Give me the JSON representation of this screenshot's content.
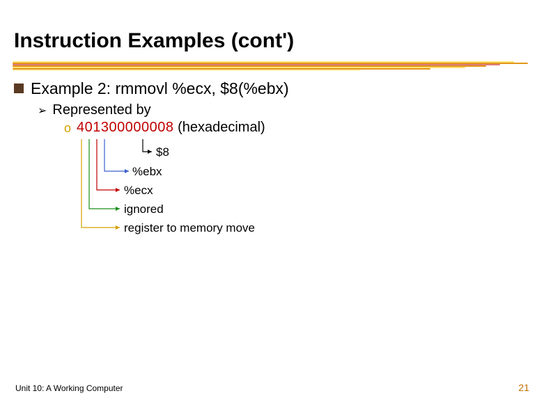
{
  "title": "Instruction Examples (cont')",
  "bullet": {
    "label": "Example 2: rmmovl %ecx, $8(%ebx)"
  },
  "sub1": {
    "label": "Represented by"
  },
  "sub2": {
    "bullet": "o",
    "hex": "401300000008",
    "paren": "(hexadecimal)"
  },
  "annotations": {
    "a0": "$8",
    "a1": "%ebx",
    "a2": "%ecx",
    "a3": "ignored",
    "a4": "register to memory move"
  },
  "footer": {
    "left": "Unit 10: A Working Computer",
    "right": "21"
  }
}
